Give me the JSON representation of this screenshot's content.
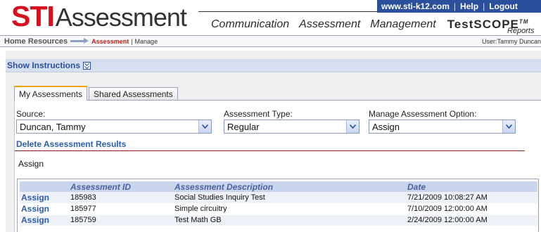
{
  "header": {
    "logo_sti": "STI",
    "logo_assessment": "Assessment",
    "top_links": [
      "www.sti-k12.com",
      "Help",
      "Logout"
    ],
    "nav": [
      "Communication",
      "Assessment",
      "Management"
    ],
    "testscope": "TestSCOPE",
    "testscope_tm": "TM",
    "testscope_sub": "Reports"
  },
  "breadcrumb": {
    "home": "Home",
    "resources": "Resources",
    "current": "Assessment",
    "separator": "|",
    "page": "Manage"
  },
  "user": "User:Tammy Duncan",
  "instructions": {
    "label": "Show Instructions"
  },
  "tabs": [
    "My Assessments",
    "Shared Assessments"
  ],
  "filters": {
    "source": {
      "label": "Source:",
      "value": "Duncan, Tammy"
    },
    "type": {
      "label": "Assessment Type:",
      "value": "Regular"
    },
    "option": {
      "label": "Manage Assessment Option:",
      "value": "Assign"
    }
  },
  "delete_link": "Delete Assessment Results",
  "section_title": "Assign",
  "table": {
    "columns": [
      "",
      "Assessment ID",
      "Assessment Description",
      "Date"
    ],
    "rows": [
      {
        "action": "Assign",
        "id": "185983",
        "description": "Social Studies Inquiry Test",
        "date": "7/21/2009 10:08:27 AM"
      },
      {
        "action": "Assign",
        "id": "185977",
        "description": "Simple circuitry",
        "date": "7/10/2009 12:00:00 AM"
      },
      {
        "action": "Assign",
        "id": "185759",
        "description": "Test Math GB",
        "date": "2/24/2009 12:00:00 AM"
      }
    ]
  },
  "colors": {
    "brand_red": "#d7101f",
    "brand_blue": "#2b4f9c",
    "link_blue": "#2b5cb0",
    "header_row": "#c9d5ec",
    "instructions_bar": "#d6dff0",
    "tab_accent": "#f0a000"
  }
}
